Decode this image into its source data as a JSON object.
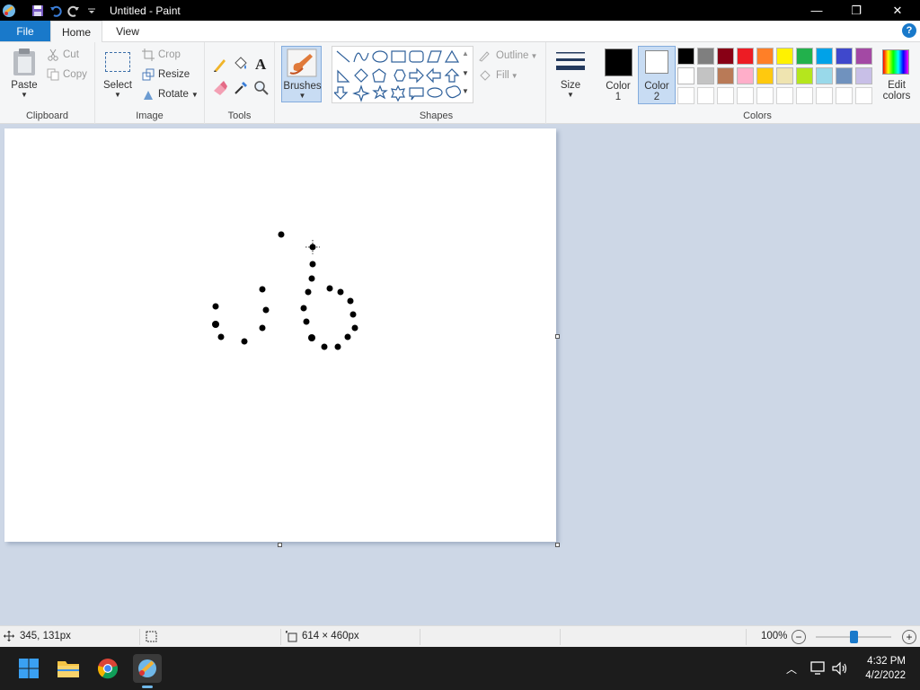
{
  "window": {
    "title": "Untitled - Paint",
    "minimize": "—",
    "maximize": "❐",
    "close": "✕"
  },
  "tabs": [
    {
      "label": "File"
    },
    {
      "label": "Home"
    },
    {
      "label": "View"
    }
  ],
  "help_label": "?",
  "ribbon": {
    "clipboard": {
      "label": "Clipboard",
      "paste": "Paste",
      "cut": "Cut",
      "copy": "Copy"
    },
    "image": {
      "label": "Image",
      "select": "Select",
      "crop": "Crop",
      "resize": "Resize",
      "rotate": "Rotate"
    },
    "tools": {
      "label": "Tools"
    },
    "brushes": {
      "label": "Brushes"
    },
    "shapes": {
      "label": "Shapes",
      "outline": "Outline",
      "fill": "Fill"
    },
    "size": {
      "label": "Size"
    },
    "colors": {
      "label": "Colors",
      "color1_line1": "Color",
      "color1_line2": "1",
      "color1_value": "#000000",
      "color2_line1": "Color",
      "color2_line2": "2",
      "color2_value": "#ffffff",
      "edit_line1": "Edit",
      "edit_line2": "colors",
      "palette_row1": [
        "#000000",
        "#7f7f7f",
        "#880015",
        "#ed1c24",
        "#ff7f27",
        "#fff200",
        "#22b14c",
        "#00a2e8",
        "#3f48cc",
        "#a349a4"
      ],
      "palette_row2": [
        "#ffffff",
        "#c3c3c3",
        "#b97a57",
        "#ffaec9",
        "#ffc90e",
        "#efe4b0",
        "#b5e61d",
        "#99d9ea",
        "#7092be",
        "#c8bfe7"
      ]
    }
  },
  "status": {
    "cursor_pos": "345, 131px",
    "canvas_size": "614 × 460px",
    "zoom": "100%"
  },
  "taskbar": {
    "time": "4:32 PM",
    "date": "4/2/2022"
  }
}
